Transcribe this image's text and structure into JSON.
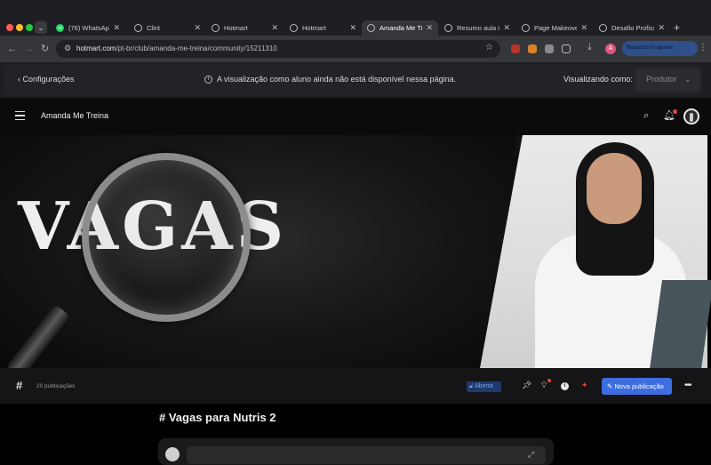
{
  "browser": {
    "tabs": [
      {
        "title": "(76) WhatsApp",
        "badge": "76"
      },
      {
        "title": "Clint"
      },
      {
        "title": "Hotmart"
      },
      {
        "title": "Hotmart"
      },
      {
        "title": "Amanda Me Tre"
      },
      {
        "title": "Resumo aula n"
      },
      {
        "title": "Page Makeove"
      },
      {
        "title": "Desafio Profiss"
      }
    ],
    "address": {
      "host": "hotmart.com",
      "path": "/pt-br/club/amanda-me-treina/community/15211310"
    },
    "profile_initial": "A",
    "update_label": "Relaunch to update"
  },
  "preview": {
    "back_label": "Configurações",
    "notice": "A visualização como aluno ainda não está disponível nessa página.",
    "viewing_label": "Visualizando como:",
    "role_value": "Produtor"
  },
  "community": {
    "name": "Amanda Me Treina",
    "hero_word": "VAGAS"
  },
  "channel": {
    "publications": "20 publicações",
    "status_badge": "Aberta",
    "new_post_label": "Nova publicação"
  },
  "content": {
    "title": "Vagas para Nutris 2"
  },
  "colors": {
    "accent": "#3d6ee0",
    "notification": "#e8433b",
    "badge_bg": "#1f3a6b"
  }
}
